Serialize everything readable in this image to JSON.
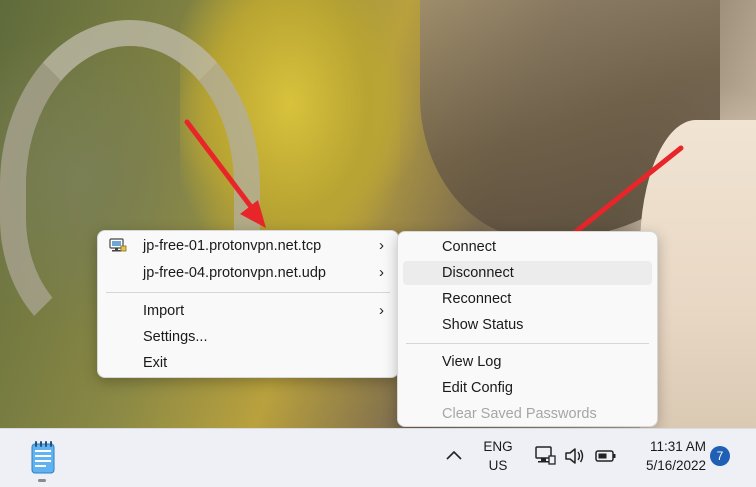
{
  "main_menu": {
    "items": [
      {
        "label": "jp-free-01.protonvpn.net.tcp",
        "has_submenu": true,
        "icon": "monitor-network-icon"
      },
      {
        "label": "jp-free-04.protonvpn.net.udp",
        "has_submenu": true
      },
      {
        "label": "Import",
        "has_submenu": true
      },
      {
        "label": "Settings..."
      },
      {
        "label": "Exit"
      }
    ]
  },
  "sub_menu": {
    "items": [
      {
        "label": "Connect"
      },
      {
        "label": "Disconnect",
        "state": "hover"
      },
      {
        "label": "Reconnect"
      },
      {
        "label": "Show Status"
      },
      {
        "label": "View Log"
      },
      {
        "label": "Edit Config"
      },
      {
        "label": "Clear Saved Passwords",
        "state": "disabled"
      }
    ]
  },
  "taskbar": {
    "language": {
      "line1": "ENG",
      "line2": "US"
    },
    "clock": {
      "time": "11:31 AM",
      "date": "5/16/2022"
    },
    "notification_count": "7",
    "icons": [
      "notepad-icon",
      "chevron-up-icon",
      "network-icon",
      "speaker-icon",
      "battery-icon"
    ]
  },
  "colors": {
    "arrow": "#e8262a",
    "badge": "#1f5fb4",
    "hover": "#ececec",
    "disabled_text": "#a6a6a6"
  }
}
